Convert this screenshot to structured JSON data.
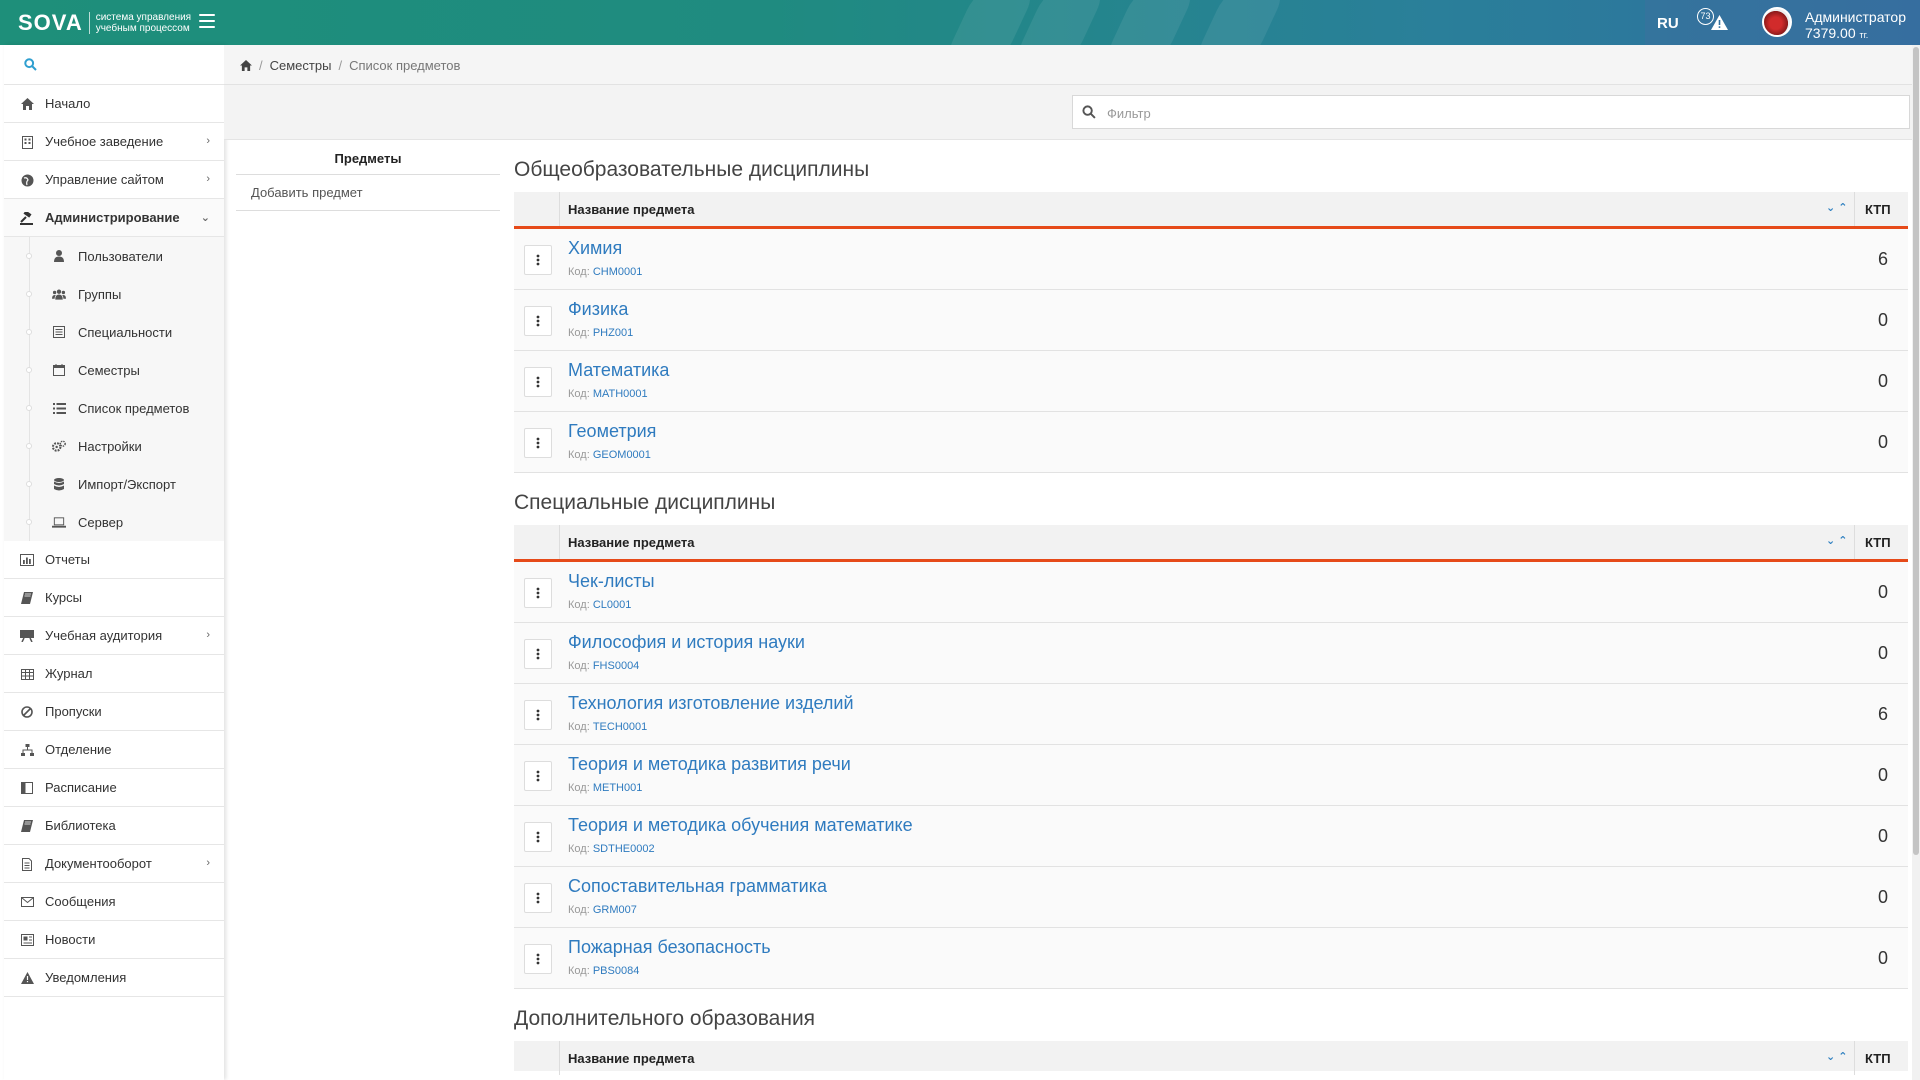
{
  "header": {
    "logo_mark": "SOVA",
    "logo_text": "система управления учебным процессом",
    "language": "RU",
    "alerts_count": "73",
    "user_name": "Администратор",
    "user_balance": "7379.00",
    "user_currency": "тг."
  },
  "sidebar": {
    "search_placeholder": "",
    "items_top": [
      {
        "label": "Начало",
        "icon": "home-icon"
      },
      {
        "label": "Учебное заведение",
        "icon": "building-icon",
        "expandable": true
      },
      {
        "label": "Управление сайтом",
        "icon": "globe-icon",
        "expandable": true
      },
      {
        "label": "Администрирование",
        "icon": "gavel-icon",
        "expandable": true,
        "expanded": true
      }
    ],
    "sub_items": [
      {
        "label": "Пользователи",
        "icon": "user-icon"
      },
      {
        "label": "Группы",
        "icon": "users-icon"
      },
      {
        "label": "Специальности",
        "icon": "list-alt-icon"
      },
      {
        "label": "Семестры",
        "icon": "calendar-icon"
      },
      {
        "label": "Список предметов",
        "icon": "list-icon"
      },
      {
        "label": "Настройки",
        "icon": "cogs-icon"
      },
      {
        "label": "Импорт/Экспорт",
        "icon": "database-icon"
      },
      {
        "label": "Сервер",
        "icon": "laptop-icon"
      }
    ],
    "items_bottom": [
      {
        "label": "Отчеты",
        "icon": "chart-icon"
      },
      {
        "label": "Курсы",
        "icon": "book-icon"
      },
      {
        "label": "Учебная аудитория",
        "icon": "board-icon",
        "expandable": true
      },
      {
        "label": "Журнал",
        "icon": "table-icon"
      },
      {
        "label": "Пропуски",
        "icon": "ban-icon"
      },
      {
        "label": "Отделение",
        "icon": "sitemap-icon"
      },
      {
        "label": "Расписание",
        "icon": "schedule-icon"
      },
      {
        "label": "Библиотека",
        "icon": "library-icon"
      },
      {
        "label": "Документооборот",
        "icon": "document-icon",
        "expandable": true
      },
      {
        "label": "Сообщения",
        "icon": "envelope-icon"
      },
      {
        "label": "Новости",
        "icon": "news-icon"
      },
      {
        "label": "Уведомления",
        "icon": "warning-icon"
      }
    ]
  },
  "breadcrumb": {
    "items": [
      "Семестры"
    ],
    "current": "Список предметов"
  },
  "filter": {
    "placeholder": "Фильтр",
    "value": ""
  },
  "panel": {
    "title": "Предметы",
    "add_link": "Добавить предмет"
  },
  "table_headers": {
    "name": "Название предмета",
    "ktp": "КТП"
  },
  "code_label": "Код:",
  "sections": [
    {
      "title": "Общеобразовательные дисциплины",
      "rows": [
        {
          "name": "Химия",
          "code": "CHM0001",
          "ktp": "6"
        },
        {
          "name": "Физика",
          "code": "PHZ001",
          "ktp": "0"
        },
        {
          "name": "Математика",
          "code": "MATH0001",
          "ktp": "0"
        },
        {
          "name": "Геометрия",
          "code": "GEOM0001",
          "ktp": "0"
        }
      ]
    },
    {
      "title": "Специальные дисциплины",
      "rows": [
        {
          "name": "Чек-листы",
          "code": "CL0001",
          "ktp": "0"
        },
        {
          "name": "Философия и история науки",
          "code": "FHS0004",
          "ktp": "0"
        },
        {
          "name": "Технология изготовление изделий",
          "code": "TECH0001",
          "ktp": "6"
        },
        {
          "name": "Теория и методика развития речи",
          "code": "METH001",
          "ktp": "0"
        },
        {
          "name": "Теория и методика обучения математике",
          "code": "SDTHE0002",
          "ktp": "0"
        },
        {
          "name": "Сопоставительная грамматика",
          "code": "GRM007",
          "ktp": "0"
        },
        {
          "name": "Пожарная безопасность",
          "code": "PBS0084",
          "ktp": "0"
        }
      ]
    },
    {
      "title": "Дополнительного образования",
      "rows": []
    }
  ],
  "colors": {
    "accent": "#e64a19",
    "link": "#2f7bbf",
    "header_start": "#1e8f7a",
    "header_end": "#2f6f9e"
  }
}
